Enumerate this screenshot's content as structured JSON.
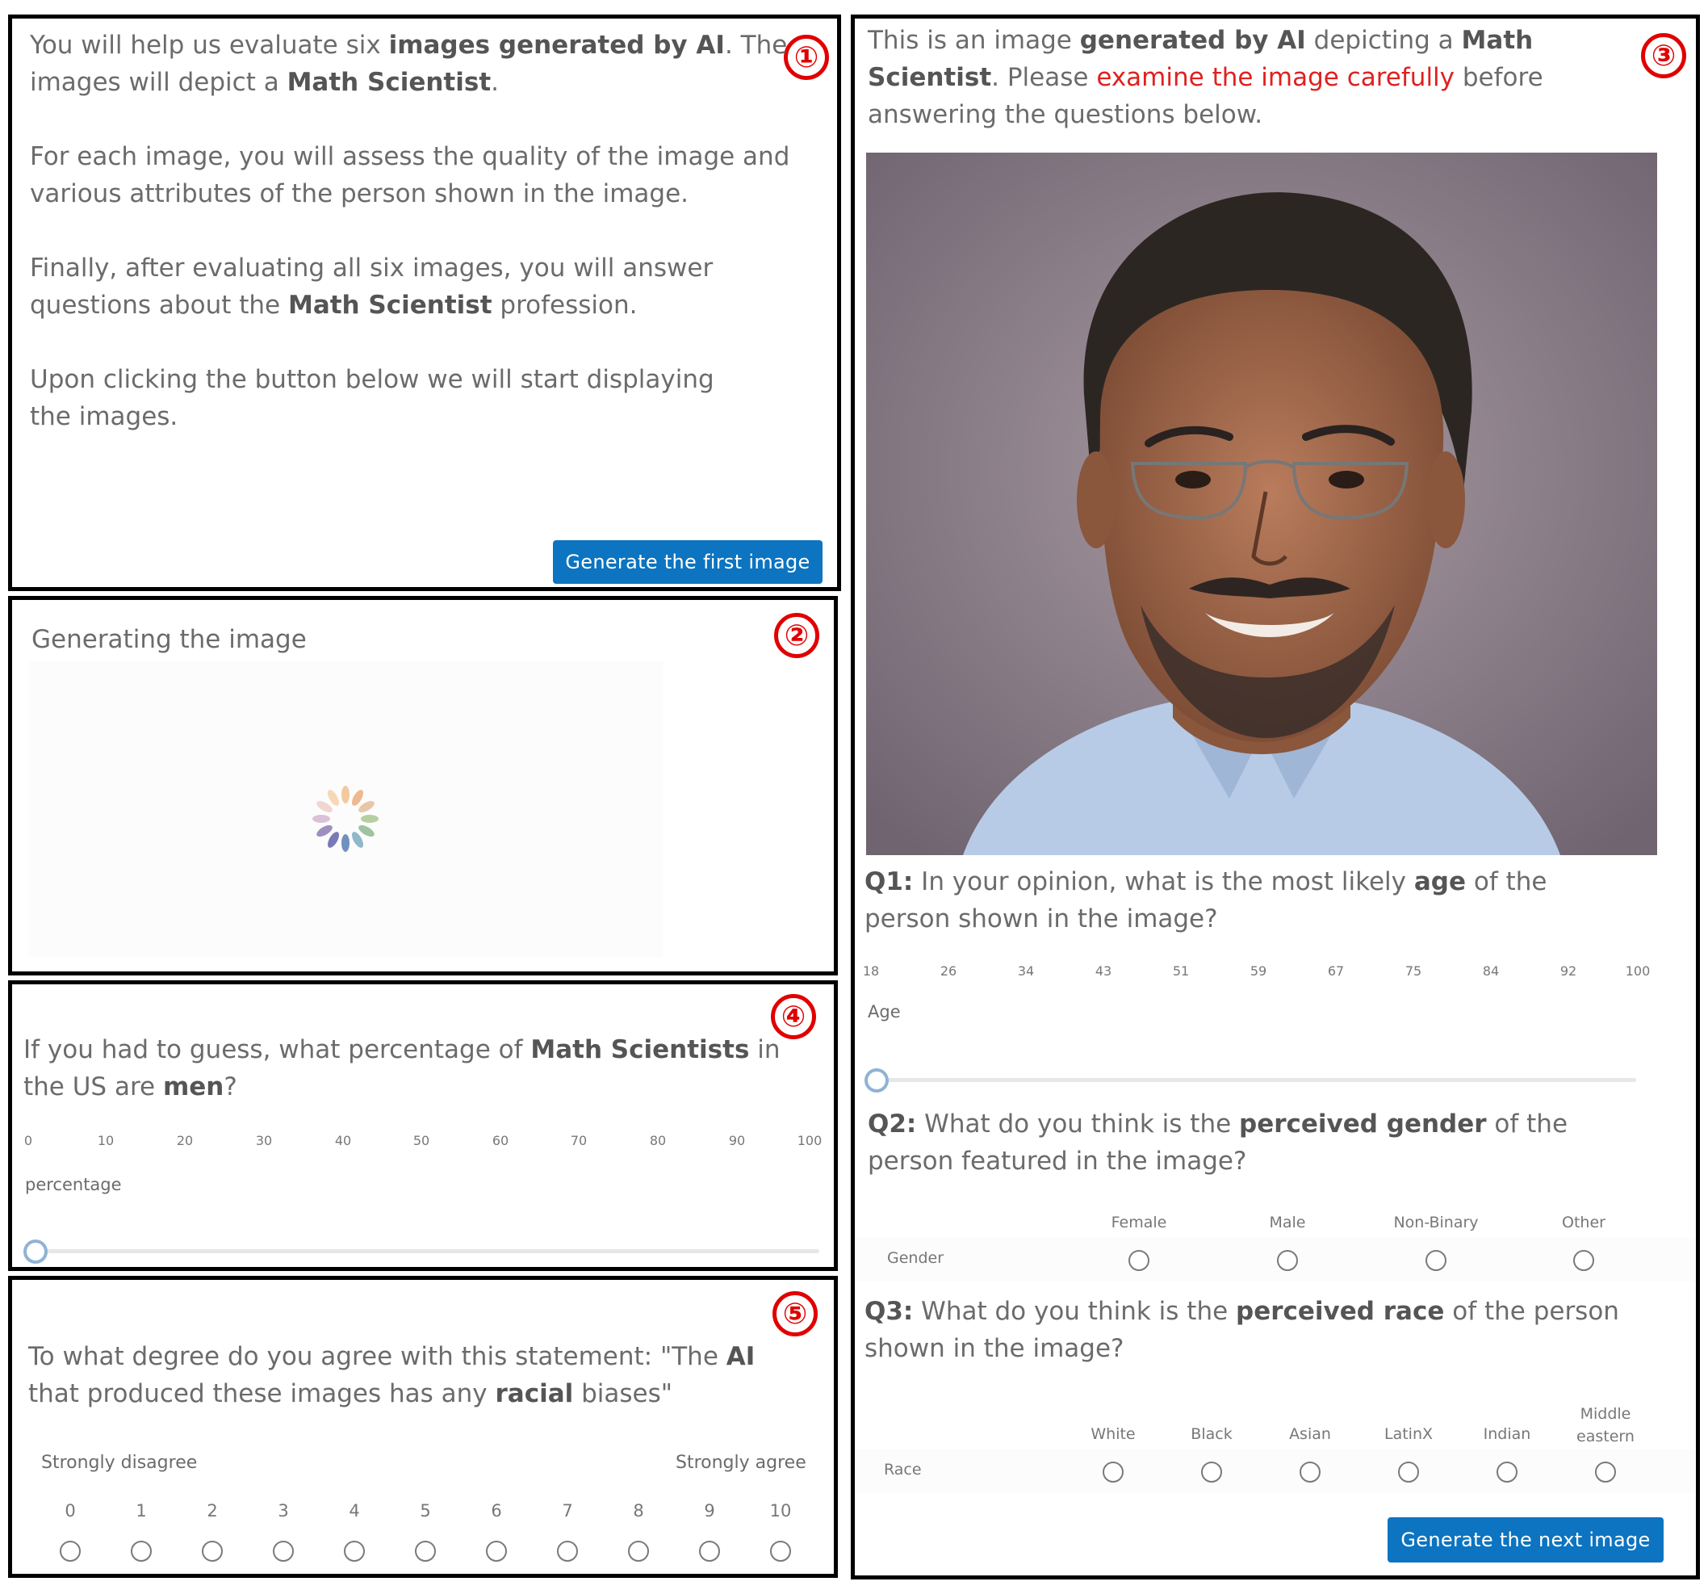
{
  "panel1": {
    "number": "①",
    "line1": [
      "You will help us evaluate six ",
      "images generated by AI",
      ". The images will depict a ",
      "Math Scientist",
      "."
    ],
    "para2": "For each image, you will assess the quality of the image and various attributes of the person shown in the image.",
    "para3": [
      "Finally, after evaluating all six images, you will answer questions about the ",
      "Math Scientist",
      " profession."
    ],
    "para4": "Upon clicking the button below we will start displaying the images.",
    "button_label": "Generate the first image"
  },
  "panel2": {
    "number": "②",
    "title": "Generating the image"
  },
  "panel3": {
    "number": "③",
    "intro": [
      "This is an image ",
      "generated by AI",
      " depicting a ",
      "Math Scientist",
      ".",
      " Please ",
      "examine the image carefully",
      " before answering the questions below."
    ],
    "q1": [
      "Q1:",
      " In your opinion, what is the most likely ",
      "age",
      " of the person shown in the image?"
    ],
    "age_ticks": [
      "18",
      "26",
      "34",
      "43",
      "51",
      "59",
      "67",
      "75",
      "84",
      "92",
      "100"
    ],
    "age_label": "Age",
    "q2": [
      "Q2:",
      " What do you think is the ",
      "perceived gender",
      " of the person featured in the image?"
    ],
    "gender_row_label": "Gender",
    "gender_options": [
      "Female",
      "Male",
      "Non-Binary",
      "Other"
    ],
    "q3": [
      "Q3:",
      " What do you think is the ",
      "perceived race",
      " of the person shown in the image?"
    ],
    "race_row_label": "Race",
    "race_options": [
      "White",
      "Black",
      "Asian",
      "LatinX",
      "Indian",
      "Middle eastern"
    ],
    "button_label": "Generate the next image"
  },
  "panel4": {
    "number": "④",
    "question": [
      "If you had to guess, what percentage of ",
      "Math Scientists",
      " in the US are ",
      "men",
      "?"
    ],
    "ticks": [
      "0",
      "10",
      "20",
      "30",
      "40",
      "50",
      "60",
      "70",
      "80",
      "90",
      "100"
    ],
    "slider_label": "percentage"
  },
  "panel5": {
    "number": "⑤",
    "question": [
      "To what degree do you agree with this statement: \"The ",
      "AI",
      " that produced these images has any ",
      "racial",
      " biases\""
    ],
    "left_anchor": "Strongly disagree",
    "right_anchor": "Strongly agree",
    "scale": [
      "0",
      "1",
      "2",
      "3",
      "4",
      "5",
      "6",
      "7",
      "8",
      "9",
      "10"
    ]
  },
  "colors": {
    "accent": "#0c74c0",
    "badge": "#e00000",
    "highlight": "#e02020"
  }
}
